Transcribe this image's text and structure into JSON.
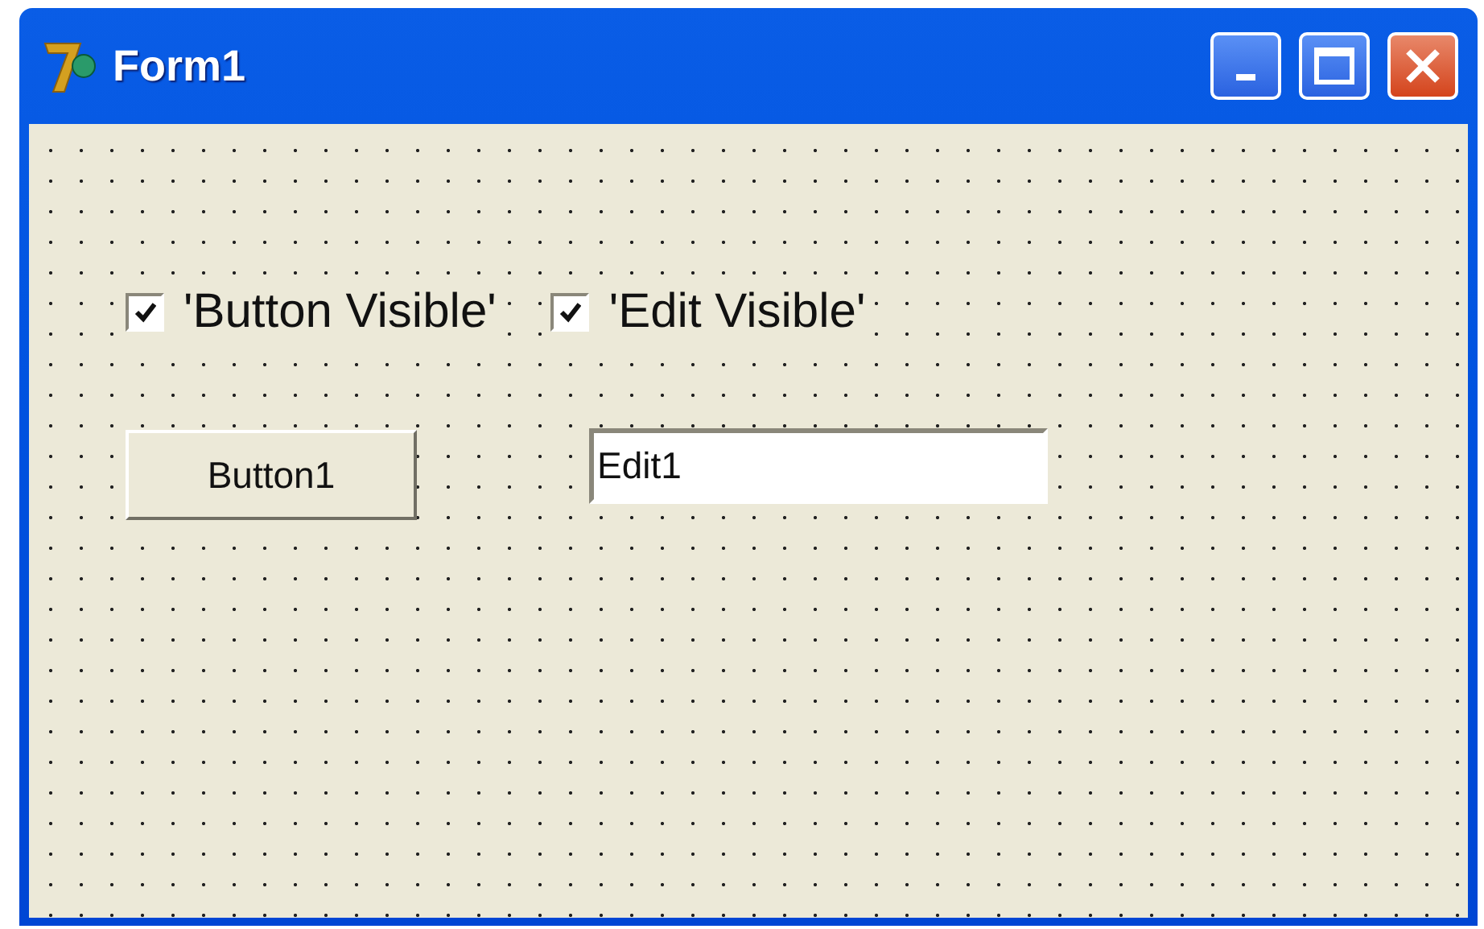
{
  "window": {
    "title": "Form1"
  },
  "checkboxes": [
    {
      "label": "'Button Visible'",
      "checked": true
    },
    {
      "label": "'Edit Visible'",
      "checked": true
    }
  ],
  "button": {
    "label": "Button1"
  },
  "edit": {
    "value": "Edit1"
  }
}
